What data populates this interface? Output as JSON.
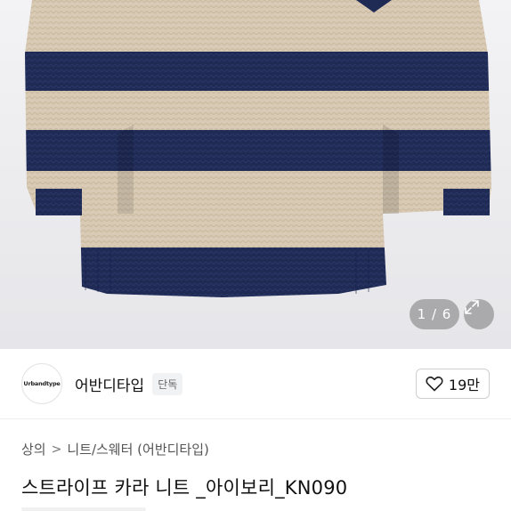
{
  "gallery": {
    "image_alt": "navy and beige striped knit sweater",
    "colors": {
      "beige": "#d9cbb7",
      "navy": "#1f2a55",
      "background": "#ececef"
    },
    "counter": "1 / 6",
    "expand_icon": "expand-icon"
  },
  "seller": {
    "logo_text": "Urbandtype",
    "name": "어반디타입",
    "badge": "단독",
    "like_icon": "heart-icon",
    "like_count": "19만"
  },
  "product": {
    "breadcrumb": [
      "상의",
      "니트/스웨터 (어반디타입)"
    ],
    "breadcrumb_sep": ">",
    "title": "스트라이프 카라 니트 _아이보리_KN090"
  }
}
